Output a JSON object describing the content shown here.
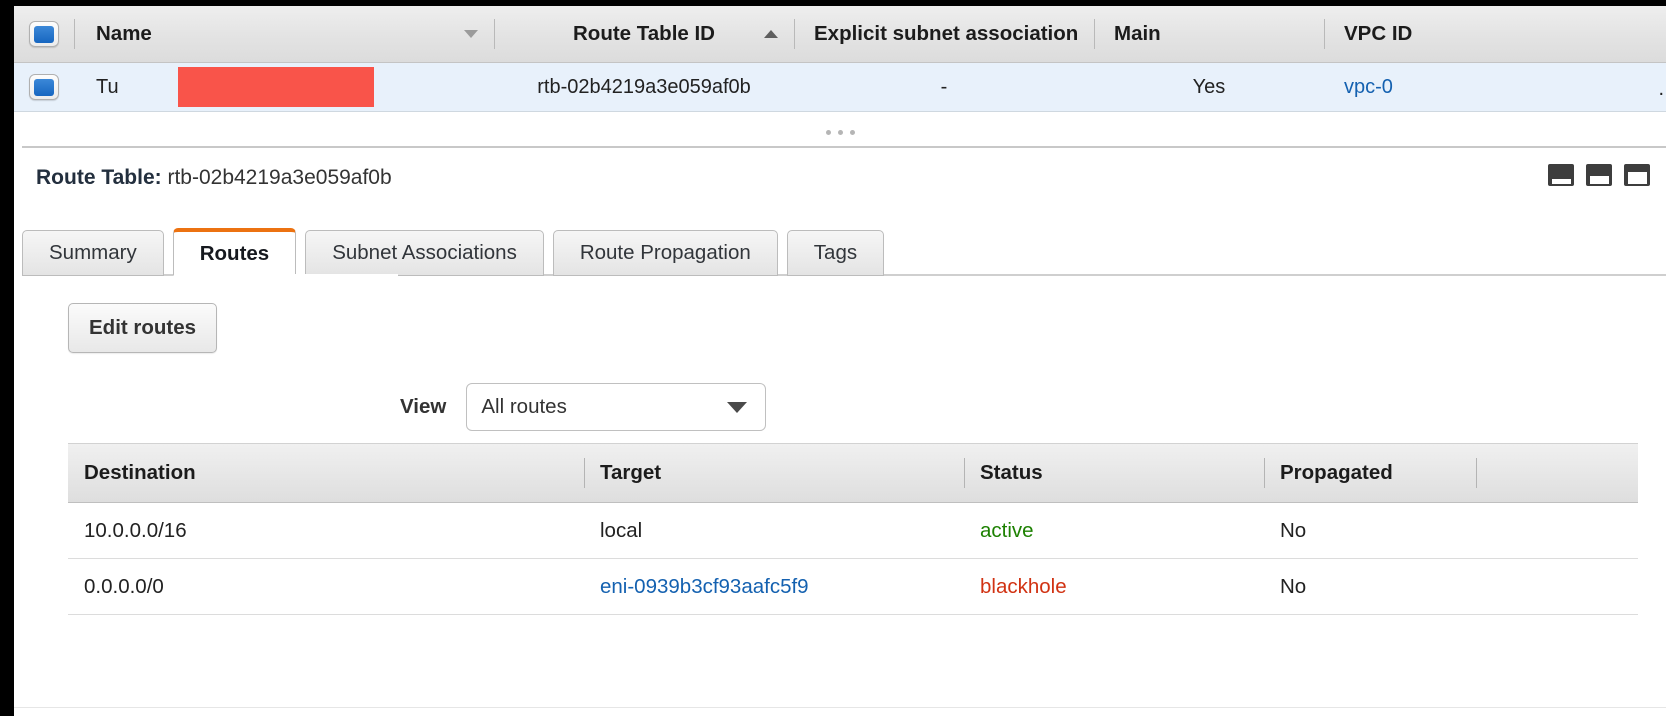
{
  "resource_table": {
    "columns": [
      {
        "label": "Name",
        "sort": "down"
      },
      {
        "label": "Route Table ID",
        "sort": "up"
      },
      {
        "label": "Explicit subnet association",
        "sort": null
      },
      {
        "label": "Main",
        "sort": null
      },
      {
        "label": "VPC ID",
        "sort": null
      }
    ],
    "row": {
      "name_prefix": "Tu",
      "route_table_id": "rtb-02b4219a3e059af0b",
      "explicit_subnet_association": "-",
      "main": "Yes",
      "vpc_id_prefix": "vpc-0",
      "trailing": "."
    }
  },
  "detail": {
    "title_label": "Route Table:",
    "title_value": "rtb-02b4219a3e059af0b",
    "panel_icons": [
      "panel-small-icon",
      "panel-medium-icon",
      "panel-large-icon"
    ],
    "tabs": [
      {
        "label": "Summary",
        "active": false
      },
      {
        "label": "Routes",
        "active": true
      },
      {
        "label": "Subnet Associations",
        "active": false
      },
      {
        "label": "Route Propagation",
        "active": false
      },
      {
        "label": "Tags",
        "active": false
      }
    ],
    "edit_routes_label": "Edit routes",
    "view": {
      "label": "View",
      "selected": "All routes"
    },
    "routes_table": {
      "columns": [
        "Destination",
        "Target",
        "Status",
        "Propagated"
      ],
      "rows": [
        {
          "destination": "10.0.0.0/16",
          "target": "local",
          "target_is_link": false,
          "status": "active",
          "status_kind": "active",
          "propagated": "No"
        },
        {
          "destination": "0.0.0.0/0",
          "target": "eni-0939b3cf93aafc5f9",
          "target_is_link": true,
          "status": "blackhole",
          "status_kind": "blackhole",
          "propagated": "No"
        }
      ]
    }
  },
  "colors": {
    "accent": "#ec7211",
    "link": "#1461b0",
    "status_active": "#1d8102",
    "status_blackhole": "#d13212",
    "redaction": "#f9544a",
    "selected_row": "#e8f1fb"
  }
}
